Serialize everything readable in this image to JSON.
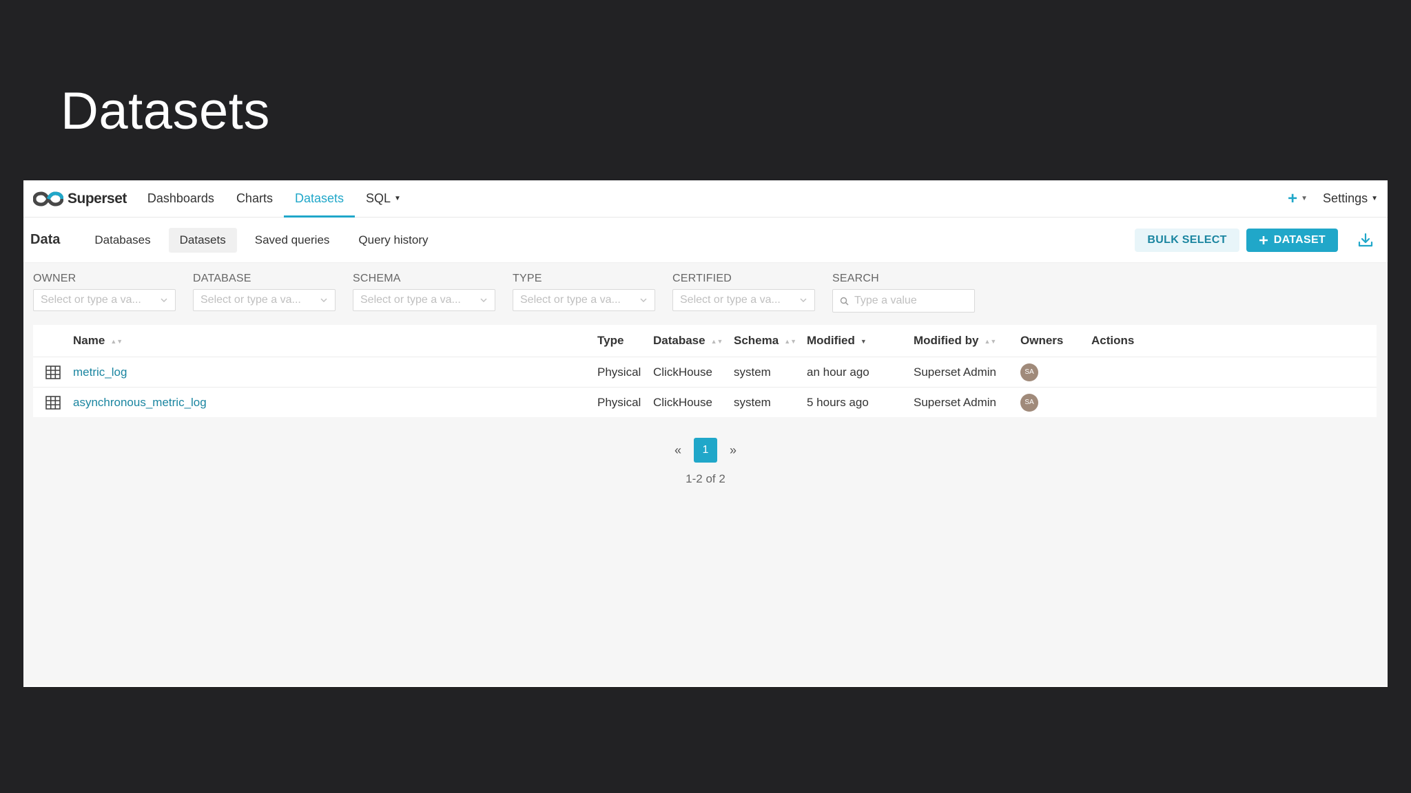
{
  "slide_title": "Datasets",
  "navbar": {
    "brand": "Superset",
    "items": [
      {
        "label": "Dashboards"
      },
      {
        "label": "Charts"
      },
      {
        "label": "Datasets"
      },
      {
        "label": "SQL"
      }
    ],
    "active": "Datasets",
    "settings_label": "Settings"
  },
  "subheader": {
    "title": "Data",
    "tabs": [
      {
        "label": "Databases"
      },
      {
        "label": "Datasets"
      },
      {
        "label": "Saved queries"
      },
      {
        "label": "Query history"
      }
    ],
    "active_tab": "Datasets",
    "bulk_select_label": "BULK SELECT",
    "add_dataset_label": "DATASET"
  },
  "filters": [
    {
      "label": "OWNER",
      "placeholder": "Select or type a va..."
    },
    {
      "label": "DATABASE",
      "placeholder": "Select or type a va..."
    },
    {
      "label": "SCHEMA",
      "placeholder": "Select or type a va..."
    },
    {
      "label": "TYPE",
      "placeholder": "Select or type a va..."
    },
    {
      "label": "CERTIFIED",
      "placeholder": "Select or type a va..."
    }
  ],
  "search": {
    "label": "SEARCH",
    "placeholder": "Type a value"
  },
  "table": {
    "columns": {
      "name": "Name",
      "type": "Type",
      "database": "Database",
      "schema": "Schema",
      "modified": "Modified",
      "modified_by": "Modified by",
      "owners": "Owners",
      "actions": "Actions"
    },
    "rows": [
      {
        "name": "metric_log",
        "type": "Physical",
        "database": "ClickHouse",
        "schema": "system",
        "modified": "an hour ago",
        "modified_by": "Superset Admin",
        "owner_initials": "SA"
      },
      {
        "name": "asynchronous_metric_log",
        "type": "Physical",
        "database": "ClickHouse",
        "schema": "system",
        "modified": "5 hours ago",
        "modified_by": "Superset Admin",
        "owner_initials": "SA"
      }
    ]
  },
  "pagination": {
    "prev": "«",
    "current_page": "1",
    "next": "»",
    "info": "1-2 of 2"
  },
  "colors": {
    "accent": "#20a7c9",
    "background": "#222224",
    "link": "#1a85a0"
  }
}
